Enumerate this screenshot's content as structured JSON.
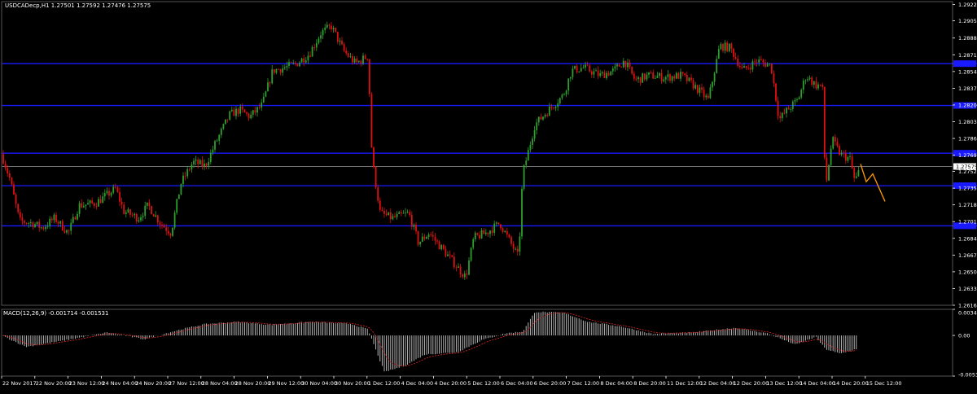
{
  "symbol_header": "USDCADecp,H1  1.27501 1.27592 1.27476 1.27575",
  "macd_header": "MACD(12,26,9) -0.001714 -0.001531",
  "colors": {
    "background": "#000000",
    "bull": "#2ca02c",
    "bear": "#e01010",
    "level_line": "#1a1aff",
    "price_line": "#9a9a9a",
    "projection": "#ff9900",
    "macd_hist": "#c8c8c8",
    "macd_signal": "#cc2222",
    "axis_text": "#ffffff",
    "grid": "#555555"
  },
  "price_axis": {
    "range": [
      1.26165,
      1.2925
    ],
    "ticks": [
      "1.29220",
      "1.29055",
      "1.28880",
      "1.28710",
      "1.28540",
      "1.28370",
      "1.28200",
      "1.28030",
      "1.27860",
      "1.27690",
      "1.27525",
      "1.27355",
      "1.27185",
      "1.27015",
      "1.26845",
      "1.26675",
      "1.26505",
      "1.26335",
      "1.26165"
    ],
    "current_price": "1.27575"
  },
  "macd_axis": {
    "ticks": [
      "0.003431",
      "0.00",
      "-0.00534"
    ]
  },
  "time_axis": {
    "labels": [
      "22 Nov 2017",
      "22 Nov 20:00",
      "23 Nov 12:00",
      "24 Nov 04:00",
      "24 Nov 20:00",
      "27 Nov 12:00",
      "28 Nov 04:00",
      "28 Nov 20:00",
      "29 Nov 12:00",
      "30 Nov 04:00",
      "30 Nov 20:00",
      "1 Dec 12:00",
      "4 Dec 04:00",
      "4 Dec 20:00",
      "5 Dec 12:00",
      "6 Dec 04:00",
      "6 Dec 20:00",
      "7 Dec 12:00",
      "8 Dec 04:00",
      "8 Dec 20:00",
      "11 Dec 12:00",
      "12 Dec 04:00",
      "12 Dec 20:00",
      "13 Dec 12:00",
      "14 Dec 04:00",
      "14 Dec 20:00",
      "15 Dec 12:00"
    ]
  },
  "chart_data": {
    "type": "candlestick",
    "series_anchors": [
      [
        0,
        1.277
      ],
      [
        10,
        1.2745
      ],
      [
        22,
        1.2702
      ],
      [
        38,
        1.27
      ],
      [
        50,
        1.2695
      ],
      [
        65,
        1.2705
      ],
      [
        82,
        1.269
      ],
      [
        95,
        1.2718
      ],
      [
        115,
        1.272
      ],
      [
        140,
        1.2735
      ],
      [
        150,
        1.2712
      ],
      [
        168,
        1.2705
      ],
      [
        180,
        1.2718
      ],
      [
        195,
        1.27
      ],
      [
        208,
        1.269
      ],
      [
        220,
        1.274
      ],
      [
        235,
        1.2762
      ],
      [
        250,
        1.2758
      ],
      [
        262,
        1.278
      ],
      [
        280,
        1.281
      ],
      [
        292,
        1.2815
      ],
      [
        305,
        1.2808
      ],
      [
        320,
        1.282
      ],
      [
        333,
        1.2855
      ],
      [
        348,
        1.2858
      ],
      [
        362,
        1.2862
      ],
      [
        378,
        1.2872
      ],
      [
        392,
        1.2893
      ],
      [
        405,
        1.29
      ],
      [
        420,
        1.2875
      ],
      [
        435,
        1.2862
      ],
      [
        450,
        1.287
      ],
      [
        455,
        1.2765
      ],
      [
        465,
        1.271
      ],
      [
        480,
        1.2705
      ],
      [
        500,
        1.271
      ],
      [
        512,
        1.268
      ],
      [
        525,
        1.269
      ],
      [
        540,
        1.2675
      ],
      [
        555,
        1.266
      ],
      [
        570,
        1.2645
      ],
      [
        580,
        1.2685
      ],
      [
        595,
        1.269
      ],
      [
        612,
        1.27
      ],
      [
        625,
        1.268
      ],
      [
        635,
        1.2665
      ],
      [
        640,
        1.275
      ],
      [
        655,
        1.28
      ],
      [
        672,
        1.2815
      ],
      [
        690,
        1.283
      ],
      [
        700,
        1.2855
      ],
      [
        715,
        1.2858
      ],
      [
        735,
        1.285
      ],
      [
        752,
        1.2855
      ],
      [
        765,
        1.2865
      ],
      [
        778,
        1.2845
      ],
      [
        795,
        1.285
      ],
      [
        815,
        1.2848
      ],
      [
        835,
        1.285
      ],
      [
        850,
        1.284
      ],
      [
        868,
        1.2825
      ],
      [
        882,
        1.288
      ],
      [
        895,
        1.2878
      ],
      [
        910,
        1.2855
      ],
      [
        928,
        1.2865
      ],
      [
        945,
        1.286
      ],
      [
        955,
        1.2805
      ],
      [
        965,
        1.2815
      ],
      [
        978,
        1.2825
      ],
      [
        988,
        1.285
      ],
      [
        1000,
        1.284
      ],
      [
        1008,
        1.284
      ],
      [
        1012,
        1.2735
      ],
      [
        1020,
        1.2785
      ],
      [
        1030,
        1.277
      ],
      [
        1042,
        1.2765
      ],
      [
        1048,
        1.2742
      ],
      [
        1055,
        1.2757
      ]
    ],
    "support_resistance_levels": [
      1.2862,
      1.28195,
      1.2771,
      1.2738,
      1.26972
    ],
    "projection_path": [
      [
        1055,
        1.276
      ],
      [
        1062,
        1.2742
      ],
      [
        1070,
        1.275
      ],
      [
        1085,
        1.2722
      ]
    ],
    "macd_anchors": [
      [
        0,
        0.0
      ],
      [
        30,
        -0.0015
      ],
      [
        80,
        -0.0006
      ],
      [
        130,
        0.0004
      ],
      [
        175,
        -0.0005
      ],
      [
        220,
        0.0008
      ],
      [
        250,
        0.0015
      ],
      [
        290,
        0.0018
      ],
      [
        330,
        0.0014
      ],
      [
        380,
        0.0018
      ],
      [
        430,
        0.0015
      ],
      [
        450,
        0.0008
      ],
      [
        470,
        -0.0048
      ],
      [
        495,
        -0.004
      ],
      [
        520,
        -0.0025
      ],
      [
        560,
        -0.0022
      ],
      [
        590,
        -0.0006
      ],
      [
        620,
        0.0003
      ],
      [
        640,
        0.0005
      ],
      [
        655,
        0.0031
      ],
      [
        690,
        0.003
      ],
      [
        720,
        0.0018
      ],
      [
        760,
        0.0012
      ],
      [
        800,
        0.0002
      ],
      [
        850,
        0.0004
      ],
      [
        900,
        0.001
      ],
      [
        940,
        0.0003
      ],
      [
        975,
        -0.0012
      ],
      [
        1000,
        -0.0002
      ],
      [
        1012,
        -0.0018
      ],
      [
        1030,
        -0.0024
      ],
      [
        1052,
        -0.0017
      ]
    ]
  }
}
